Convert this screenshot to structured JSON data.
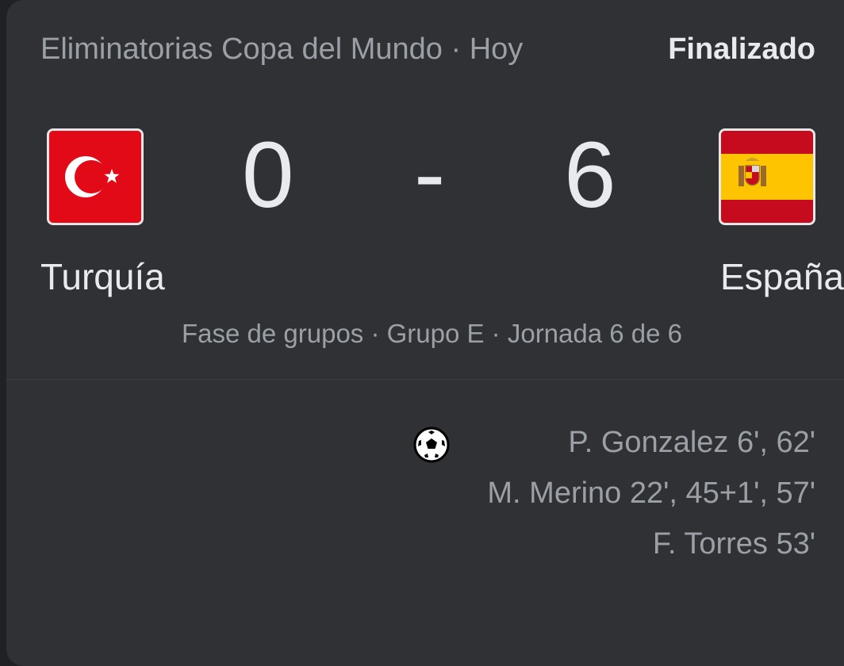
{
  "header": {
    "competition": "Eliminatorias Copa del Mundo · Hoy",
    "status": "Finalizado"
  },
  "match": {
    "home": {
      "name": "Turquía",
      "score": "0",
      "flag_icon": "turkey-flag-icon"
    },
    "separator": "-",
    "away": {
      "name": "España",
      "score": "6",
      "flag_icon": "spain-flag-icon"
    },
    "round": "Fase de grupos · Grupo E · Jornada 6 de 6"
  },
  "goals": {
    "icon": "soccer-ball-icon",
    "away_scorers": [
      "P. Gonzalez 6', 62'",
      "M. Merino 22', 45+1', 57'",
      "F. Torres 53'"
    ]
  },
  "colors": {
    "card_bg": "#303134",
    "primary_text": "#e8eaed",
    "secondary_text": "#9aa0a6",
    "turkey_red": "#e30a17",
    "spain_red": "#c60b1e",
    "spain_yellow": "#ffc400"
  }
}
